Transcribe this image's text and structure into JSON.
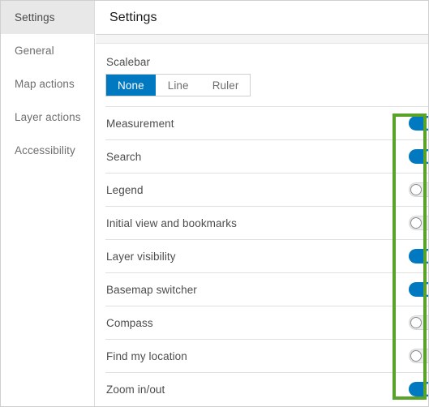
{
  "sidebar": {
    "items": [
      {
        "label": "Settings",
        "active": true
      },
      {
        "label": "General",
        "active": false
      },
      {
        "label": "Map actions",
        "active": false
      },
      {
        "label": "Layer actions",
        "active": false
      },
      {
        "label": "Accessibility",
        "active": false
      }
    ]
  },
  "panel": {
    "title": "Settings"
  },
  "scalebar": {
    "label": "Scalebar",
    "options": [
      {
        "label": "None",
        "selected": true
      },
      {
        "label": "Line",
        "selected": false
      },
      {
        "label": "Ruler",
        "selected": false
      }
    ]
  },
  "toggles": [
    {
      "label": "Measurement",
      "state": "on"
    },
    {
      "label": "Search",
      "state": "on"
    },
    {
      "label": "Legend",
      "state": "off"
    },
    {
      "label": "Initial view and bookmarks",
      "state": "off"
    },
    {
      "label": "Layer visibility",
      "state": "on"
    },
    {
      "label": "Basemap switcher",
      "state": "on"
    },
    {
      "label": "Compass",
      "state": "off"
    },
    {
      "label": "Find my location",
      "state": "off"
    },
    {
      "label": "Zoom in/out",
      "state": "on"
    }
  ],
  "colors": {
    "accent_blue": "#0079c1",
    "highlight_green": "#5aa32a",
    "sidebar_active_bg": "#e8e8e8",
    "divider": "#e0e0e0",
    "text_primary": "#4c4c4c",
    "text_muted": "#6e6e6e"
  },
  "annotation": {
    "name": "toggle-column-highlight"
  }
}
